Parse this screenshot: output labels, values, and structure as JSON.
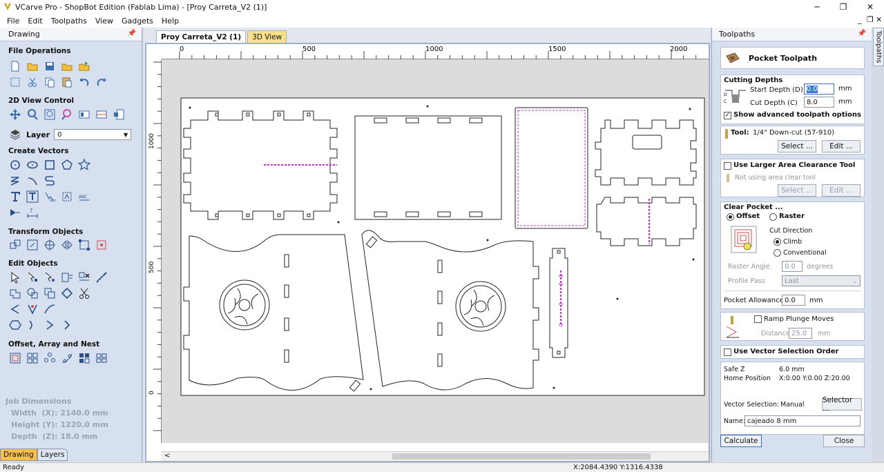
{
  "window": {
    "title": "VCarve Pro - ShopBot Edition (Fablab Lima) - [Proy Carreta_V2 (1)]"
  },
  "menu": [
    "File",
    "Edit",
    "Toolpaths",
    "View",
    "Gadgets",
    "Help"
  ],
  "left_panel": {
    "title": "Drawing",
    "sections": {
      "file_ops": "File Operations",
      "view_ctrl": "2D View Control",
      "create_vectors": "Create Vectors",
      "transform": "Transform Objects",
      "edit_objects": "Edit Objects",
      "offset": "Offset, Array and Nest"
    },
    "layer_label": "Layer",
    "layer_value": "0",
    "job_dimensions": {
      "title": "Job Dimensions",
      "width": "Width  (X): 2140.0 mm",
      "height": "Height (Y): 1220.0 mm",
      "depth": "Depth  (Z): 18.0 mm"
    },
    "tabs": [
      "Drawing",
      "Layers"
    ]
  },
  "doc_tabs": [
    "Proy Carreta_V2 (1)",
    "3D View"
  ],
  "ruler": {
    "h_labels": [
      "0",
      "500",
      "1000",
      "1500",
      "2000"
    ],
    "v_labels": [
      "1000",
      "500",
      "0"
    ]
  },
  "right_panel": {
    "title": "Toolpaths",
    "side_tab": "Toolpaths",
    "header": "Pocket Toolpath",
    "cutting_depths": {
      "title": "Cutting Depths",
      "start_label": "Start Depth (D)",
      "start_value": "0.0",
      "cut_label": "Cut Depth (C)",
      "cut_value": "8.0",
      "unit": "mm",
      "advanced": "Show advanced toolpath options"
    },
    "tool": {
      "label": "Tool:",
      "value": "1/4\" Down-cut (57-910)",
      "select": "Select ...",
      "edit": "Edit ..."
    },
    "clearance": {
      "title": "Use Larger Area Clearance Tool",
      "note": "Not using area clear tool",
      "select": "Select ...",
      "edit": "Edit ..."
    },
    "clear_pocket": {
      "title": "Clear Pocket ...",
      "offset": "Offset",
      "raster": "Raster",
      "cut_direction": "Cut Direction",
      "climb": "Climb",
      "conventional": "Conventional",
      "raster_angle_label": "Raster Angle",
      "raster_angle_value": "0.0",
      "raster_angle_unit": "degrees",
      "profile_pass_label": "Profile Pass",
      "profile_pass_value": "Last",
      "allowance_label": "Pocket Allowance",
      "allowance_value": "0.0",
      "allowance_unit": "mm"
    },
    "ramp": {
      "label": "Ramp Plunge Moves",
      "distance_label": "Distance",
      "distance_value": "25.0",
      "unit": "mm"
    },
    "vector_order": "Use Vector Selection Order",
    "safe_z_label": "Safe Z",
    "safe_z_value": "6.0 mm",
    "home_label": "Home Position",
    "home_value": "X:0.00 Y:0.00 Z:20.00",
    "vector_selection_label": "Vector Selection:",
    "vector_selection_value": "Manual",
    "selector_button": "Selector ...",
    "name_label": "Name:",
    "name_value": "cajeado 8 mm",
    "calculate": "Calculate",
    "close": "Close"
  },
  "status": {
    "left": "Ready",
    "coords": "X:2084.4390 Y:1316.4338"
  }
}
